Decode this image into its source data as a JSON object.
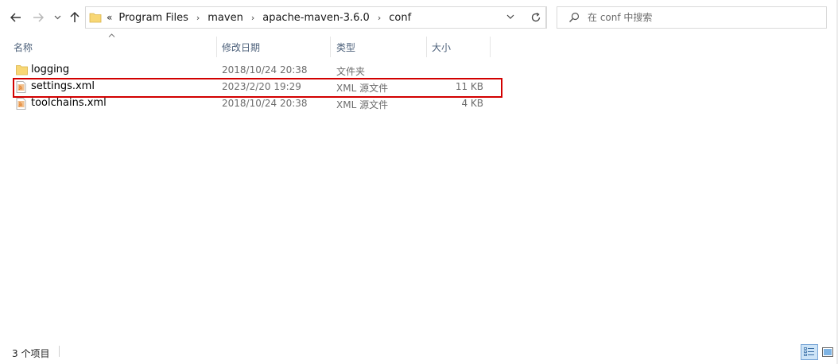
{
  "nav": {
    "back_icon": "arrow-left-icon",
    "forward_icon": "arrow-right-icon",
    "recent_icon": "chevron-down-icon",
    "up_icon": "arrow-up-icon"
  },
  "address": {
    "overflow": "«",
    "crumbs": [
      "Program Files",
      "maven",
      "apache-maven-3.6.0",
      "conf"
    ],
    "separator": "›"
  },
  "search": {
    "placeholder": "在 conf 中搜索"
  },
  "columns": {
    "name": "名称",
    "modified": "修改日期",
    "type": "类型",
    "size": "大小"
  },
  "files": [
    {
      "name": "logging",
      "modified": "2018/10/24 20:38",
      "type": "文件夹",
      "size": "",
      "icon": "folder-icon"
    },
    {
      "name": "settings.xml",
      "modified": "2023/2/20 19:29",
      "type": "XML 源文件",
      "size": "11 KB",
      "icon": "xml-file-icon",
      "highlighted": true
    },
    {
      "name": "toolchains.xml",
      "modified": "2018/10/24 20:38",
      "type": "XML 源文件",
      "size": "4 KB",
      "icon": "xml-file-icon"
    }
  ],
  "status": {
    "item_count": "3 个项目"
  },
  "colors": {
    "highlight_border": "#d20000",
    "header_text": "#4c607a",
    "folder_yellow": "#f8d775",
    "xml_icon": "#e07b24"
  }
}
